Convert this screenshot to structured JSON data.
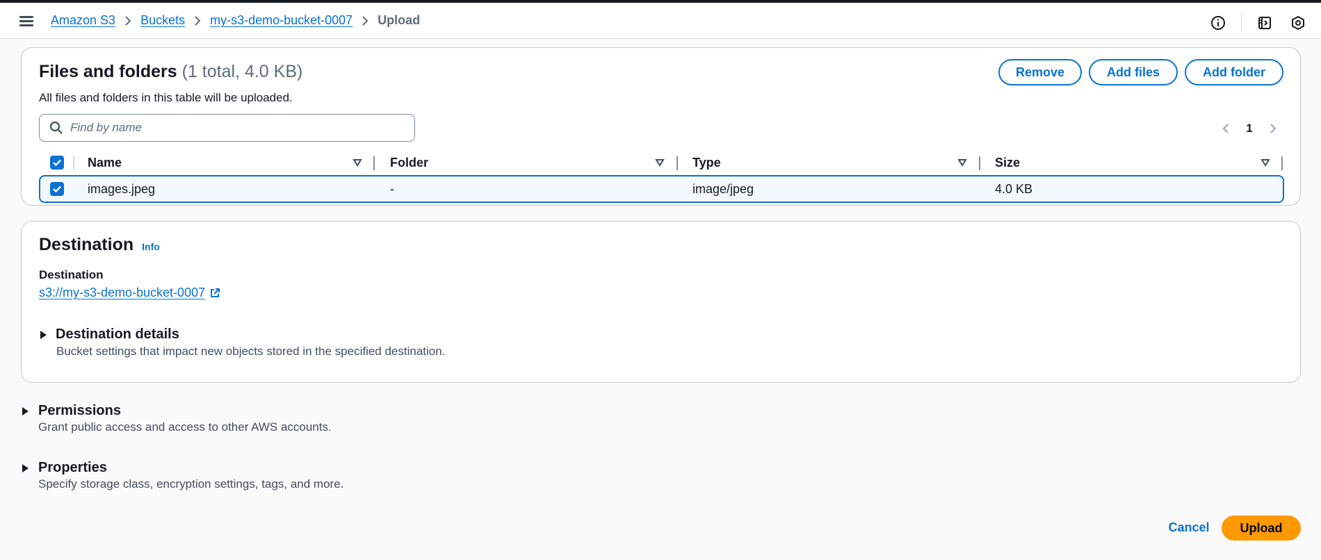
{
  "header": {
    "breadcrumbs": [
      {
        "label": "Amazon S3"
      },
      {
        "label": "Buckets"
      },
      {
        "label": "my-s3-demo-bucket-0007"
      },
      {
        "label": "Upload"
      }
    ],
    "icons": [
      "info-icon",
      "feedback-panel-icon",
      "settings-hex-icon"
    ]
  },
  "files": {
    "title": "Files and folders",
    "count": "(1 total, 4.0 KB)",
    "description": "All files and folders in this table will be uploaded.",
    "remove_label": "Remove",
    "add_files_label": "Add files",
    "add_folder_label": "Add folder",
    "search_placeholder": "Find by name",
    "page": "1",
    "columns": [
      "Name",
      "Folder",
      "Type",
      "Size"
    ],
    "rows": [
      {
        "name": "images.jpeg",
        "folder": "-",
        "type": "image/jpeg",
        "size": "4.0 KB",
        "selected": true
      }
    ]
  },
  "destination": {
    "title": "Destination",
    "info_label": "Info",
    "label": "Destination",
    "uri": "s3://my-s3-demo-bucket-0007",
    "details_title": "Destination details",
    "details_desc": "Bucket settings that impact new objects stored in the specified destination."
  },
  "permissions": {
    "title": "Permissions",
    "desc": "Grant public access and access to other AWS accounts."
  },
  "properties": {
    "title": "Properties",
    "desc": "Specify storage class, encryption settings, tags, and more."
  },
  "footer": {
    "cancel_label": "Cancel",
    "upload_label": "Upload"
  },
  "colors": {
    "link": "#0972d3",
    "primary_button": "#ff9900",
    "selected_row_bg": "#f2f8fd"
  }
}
